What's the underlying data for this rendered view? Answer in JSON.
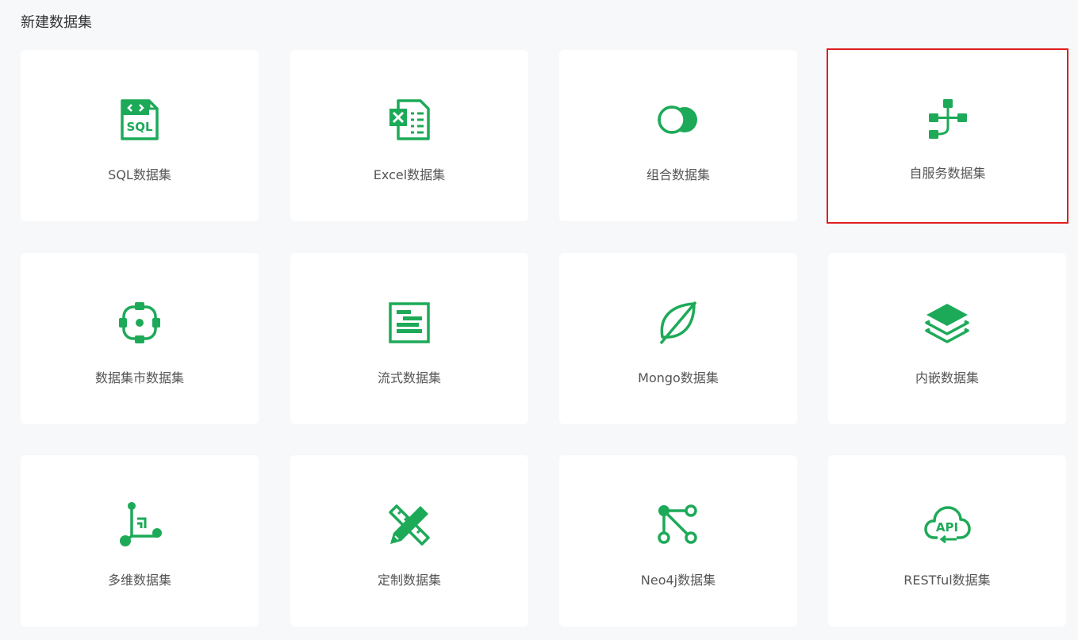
{
  "page": {
    "title": "新建数据集"
  },
  "colors": {
    "accent": "#1daa58",
    "highlight_border": "#e01e1e"
  },
  "cards": [
    {
      "label": "SQL数据集",
      "icon": "sql-file-icon"
    },
    {
      "label": "Excel数据集",
      "icon": "excel-file-icon"
    },
    {
      "label": "组合数据集",
      "icon": "venn-circles-icon"
    },
    {
      "label": "自服务数据集",
      "icon": "flow-nodes-icon",
      "highlighted": true
    },
    {
      "label": "数据集市数据集",
      "icon": "target-circle-icon"
    },
    {
      "label": "流式数据集",
      "icon": "stream-list-icon"
    },
    {
      "label": "Mongo数据集",
      "icon": "leaf-icon"
    },
    {
      "label": "内嵌数据集",
      "icon": "layers-icon"
    },
    {
      "label": "多维数据集",
      "icon": "cube-axes-icon"
    },
    {
      "label": "定制数据集",
      "icon": "pencil-ruler-icon"
    },
    {
      "label": "Neo4j数据集",
      "icon": "graph-nodes-icon"
    },
    {
      "label": "RESTful数据集",
      "icon": "api-cloud-icon"
    }
  ]
}
